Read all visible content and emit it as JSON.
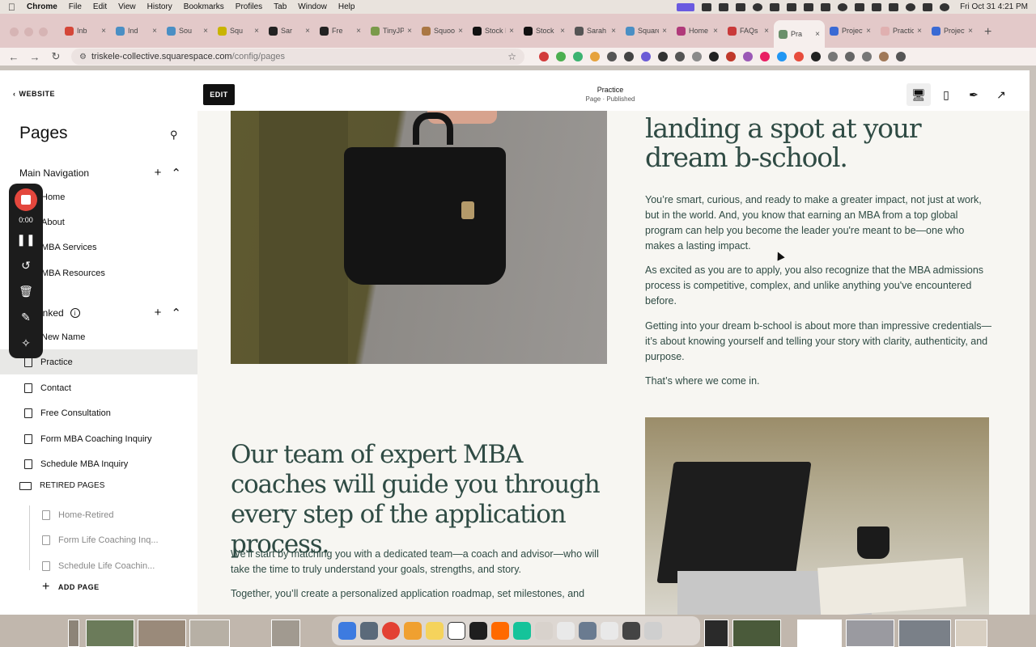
{
  "menubar": {
    "app": "Chrome",
    "items": [
      "File",
      "Edit",
      "View",
      "History",
      "Bookmarks",
      "Profiles",
      "Tab",
      "Window",
      "Help"
    ],
    "clock": "Fri Oct 31  4:21 PM"
  },
  "tabs": [
    {
      "label": "Inb",
      "color": "#d44638"
    },
    {
      "label": "Ind",
      "color": "#4a8fc4"
    },
    {
      "label": "Sou",
      "color": "#4a8fc4"
    },
    {
      "label": "Squ",
      "color": "#c9b400"
    },
    {
      "label": "Sar",
      "color": "#222222"
    },
    {
      "label": "Fre",
      "color": "#222222"
    },
    {
      "label": "TinyJP",
      "color": "#7a9a4a"
    },
    {
      "label": "Squoo",
      "color": "#aa7744"
    },
    {
      "label": "Stock I",
      "color": "#111111"
    },
    {
      "label": "Stock",
      "color": "#111111"
    },
    {
      "label": "Sarah",
      "color": "#555555"
    },
    {
      "label": "Square",
      "color": "#4a8fc4"
    },
    {
      "label": "Home",
      "color": "#b03a7a"
    },
    {
      "label": "FAQs",
      "color": "#c93a3a"
    },
    {
      "label": "Pra",
      "color": "#6a8f6a",
      "active": true
    },
    {
      "label": "Project",
      "color": "#3a6ad4"
    },
    {
      "label": "Practic",
      "color": "#e0b0b0"
    },
    {
      "label": "Project",
      "color": "#3a6ad4"
    }
  ],
  "address": {
    "domain": "triskele-collective.squarespace.com",
    "path": "/config/pages"
  },
  "sidebar": {
    "back_label": "WEBSITE",
    "title": "Pages",
    "main_nav_label": "Main Navigation",
    "main_nav_items": [
      "Home",
      "About",
      "MBA Services",
      "MBA Resources"
    ],
    "not_linked_label": "inked",
    "not_linked_items": [
      "New Name",
      "Practice",
      "Contact",
      "Free Consultation",
      "Form MBA Coaching Inquiry",
      "Schedule MBA Inquiry"
    ],
    "retired_label": "RETIRED PAGES",
    "retired_items": [
      "Home-Retired",
      "Form Life Coaching Inq...",
      "Schedule Life Coachin..."
    ],
    "add_page_label": "ADD PAGE",
    "active_item": "Practice"
  },
  "recorder": {
    "time": "0:00"
  },
  "editor": {
    "edit_label": "EDIT",
    "page_title": "Practice",
    "page_status": "Page · Published"
  },
  "content": {
    "hero_heading": "landing a spot at your dream b-school.",
    "paragraphs": [
      "You’re smart, curious, and ready to make a greater impact, not just at work, but in the world. And, you know that earning an MBA from a top global program can help you become the leader you're meant to be—one who makes a lasting impact.",
      "As excited as you are to apply, you also recognize that the MBA admissions process is competitive, complex, and unlike anything you've encountered before.",
      "Getting into your dream b-school is about more than impressive credentials—it’s about knowing yourself and telling your story with clarity, authenticity, and purpose.",
      "That’s where we come in."
    ],
    "team_heading": "Our team of expert MBA coaches will guide you through every step of the application process.",
    "team_paragraphs": [
      "We’ll start by matching you with a dedicated team—a coach and advisor—who will take the time to truly understand your goals, strengths, and story.",
      "Together, you’ll create a personalized application roadmap, set milestones, and"
    ]
  },
  "colors": {
    "heading_text": "#2f4b44",
    "tab_strip": "#e3c9c9",
    "record_red": "#e4473d"
  }
}
